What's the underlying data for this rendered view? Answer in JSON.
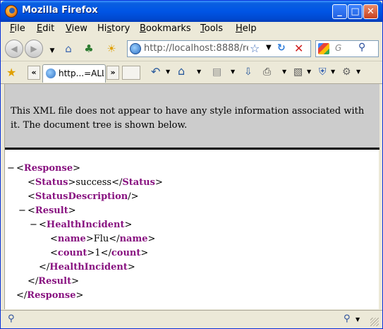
{
  "window": {
    "title": "Mozilla Firefox"
  },
  "menu": [
    {
      "prefix": "",
      "underline": "F",
      "rest": "ile"
    },
    {
      "prefix": "",
      "underline": "E",
      "rest": "dit"
    },
    {
      "prefix": "",
      "underline": "V",
      "rest": "iew"
    },
    {
      "prefix": "Hi",
      "underline": "s",
      "rest": "tory"
    },
    {
      "prefix": "",
      "underline": "B",
      "rest": "ookmarks"
    },
    {
      "prefix": "",
      "underline": "T",
      "rest": "ools"
    },
    {
      "prefix": "",
      "underline": "H",
      "rest": "elp"
    }
  ],
  "nav": {
    "url": "http://localhost:8888/re",
    "search_placeholder": "G"
  },
  "tab": {
    "label": "http...=ALL",
    "scroll_left": "«",
    "scroll_right": "»"
  },
  "content": {
    "info_text": "This XML file does not appear to have any style information associated with it. The document tree is shown below."
  },
  "xml": {
    "response_tag": "Response",
    "status_tag": "Status",
    "status_value": "success",
    "status_description_tag": "StatusDescription",
    "result_tag": "Result",
    "health_incident_tag": "HealthIncident",
    "name_tag": "name",
    "name_value": "Flu",
    "count_tag": "count",
    "count_value": "1",
    "toggle_symbol": "−"
  },
  "colors": {
    "titlebar": "#0055e5",
    "chrome": "#ece9d8",
    "xml_info_bg": "#cccccc",
    "tag": "#881280"
  },
  "icons": {
    "back": "back-icon",
    "forward": "forward-icon",
    "home": "home-icon",
    "evernote": "evernote-icon",
    "weather": "weather-icon",
    "bookmark_star": "bookmark-star-icon",
    "reload": "reload-icon",
    "stop": "stop-icon",
    "search": "search-icon",
    "zoom": "zoom-icon"
  }
}
